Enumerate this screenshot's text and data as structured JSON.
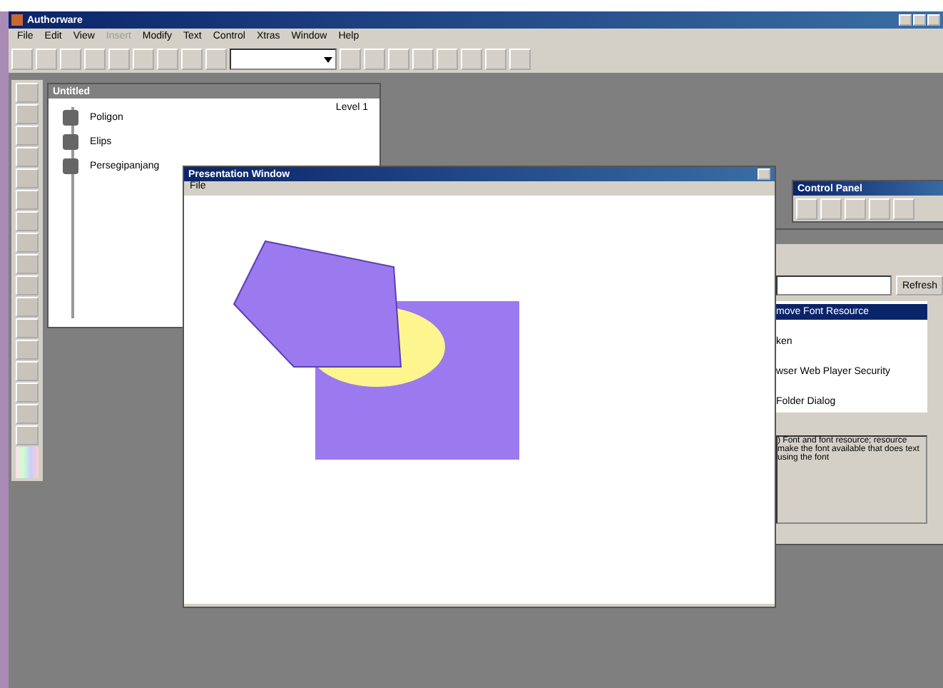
{
  "app": {
    "title": "Authorware"
  },
  "menu": [
    {
      "label": "File",
      "disabled": false
    },
    {
      "label": "Edit",
      "disabled": false
    },
    {
      "label": "View",
      "disabled": false
    },
    {
      "label": "Insert",
      "disabled": true
    },
    {
      "label": "Modify",
      "disabled": false
    },
    {
      "label": "Text",
      "disabled": false
    },
    {
      "label": "Control",
      "disabled": false
    },
    {
      "label": "Xtras",
      "disabled": false
    },
    {
      "label": "Window",
      "disabled": false
    },
    {
      "label": "Help",
      "disabled": false
    }
  ],
  "flowline": {
    "title": "Untitled",
    "level": "Level 1",
    "icons": [
      {
        "label": "Poligon"
      },
      {
        "label": "Elips"
      },
      {
        "label": "Persegipanjang"
      }
    ]
  },
  "presentation": {
    "title": "Presentation Window",
    "menu": "File"
  },
  "control_panel": {
    "title": "Control Panel"
  },
  "functions": {
    "refresh": "Refresh",
    "items": [
      {
        "label": "move Font Resource",
        "selected": true
      },
      {
        "label": "ken",
        "selected": false
      },
      {
        "label": "wser Web Player Security",
        "selected": false
      },
      {
        "label": "Folder Dialog",
        "selected": false
      }
    ],
    "description": ") Font and font resource; resource make the font available that does text using the font"
  }
}
